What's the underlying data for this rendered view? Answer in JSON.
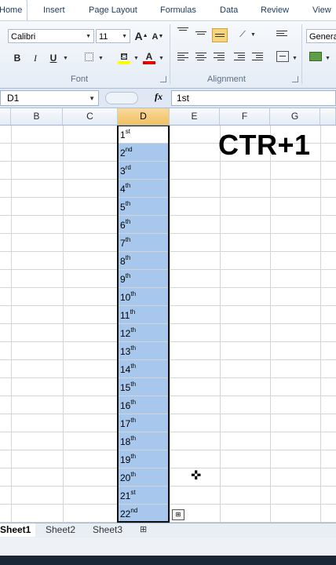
{
  "ribbon_tabs": [
    "Home",
    "Insert",
    "Page Layout",
    "Formulas",
    "Data",
    "Review",
    "View"
  ],
  "font": {
    "name": "Calibri",
    "size": "11",
    "group_label": "Font",
    "bold": "B",
    "italic": "I",
    "underline": "U",
    "grow": "A",
    "shrink": "A",
    "font_color": "A"
  },
  "alignment": {
    "group_label": "Alignment"
  },
  "number": {
    "format": "Genera"
  },
  "formula_bar": {
    "name_box": "D1",
    "fx": "fx",
    "content": "1st"
  },
  "columns": [
    "B",
    "C",
    "D",
    "E",
    "F",
    "G"
  ],
  "cells": [
    {
      "num": "1",
      "suffix": "st"
    },
    {
      "num": "2",
      "suffix": "nd"
    },
    {
      "num": "3",
      "suffix": "rd"
    },
    {
      "num": "4",
      "suffix": "th"
    },
    {
      "num": "5",
      "suffix": "th"
    },
    {
      "num": "6",
      "suffix": "th"
    },
    {
      "num": "7",
      "suffix": "th"
    },
    {
      "num": "8",
      "suffix": "th"
    },
    {
      "num": "9",
      "suffix": "th"
    },
    {
      "num": "10",
      "suffix": "th"
    },
    {
      "num": "11",
      "suffix": "th"
    },
    {
      "num": "12",
      "suffix": "th"
    },
    {
      "num": "13",
      "suffix": "th"
    },
    {
      "num": "14",
      "suffix": "th"
    },
    {
      "num": "15",
      "suffix": "th"
    },
    {
      "num": "16",
      "suffix": "th"
    },
    {
      "num": "17",
      "suffix": "th"
    },
    {
      "num": "18",
      "suffix": "th"
    },
    {
      "num": "19",
      "suffix": "th"
    },
    {
      "num": "20",
      "suffix": "th"
    },
    {
      "num": "21",
      "suffix": "st"
    },
    {
      "num": "22",
      "suffix": "nd"
    }
  ],
  "overlay_text": "CTR+1",
  "sheets": [
    "Sheet1",
    "Sheet2",
    "Sheet3"
  ],
  "colors": {
    "selection": "#a7c8ec",
    "selected_header": "#f1c15f",
    "ribbon_text": "#1e395b"
  }
}
